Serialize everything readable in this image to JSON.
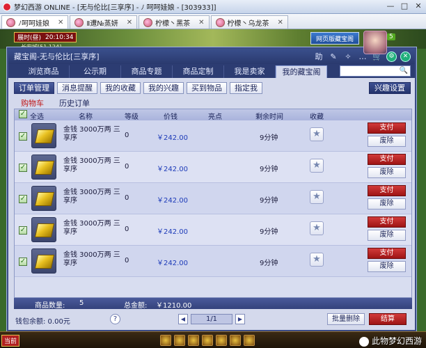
{
  "window": {
    "title": "梦幻西游 ONLINE - [无与伦比[三享序] - ﾉ 呵呵娃娘 - [303933]]",
    "minimize": "—",
    "maximize": "□",
    "close": "✕"
  },
  "game_tabs": [
    {
      "label": "ﾉ呵呵娃娘"
    },
    {
      "label": "Ⅱ遭№蒸妍"
    },
    {
      "label": "柠檬丶黑茶"
    },
    {
      "label": "柠檬丶乌龙茶"
    }
  ],
  "hud": {
    "clock_label": "展时(昼)",
    "clock_time": "20:10:34",
    "location": "长安城[51,124]",
    "web_button": "网页版藏宝阁",
    "level": "5"
  },
  "panel": {
    "title": "藏宝阁-无与伦比[三享序]",
    "controls": {
      "help": "助",
      "edit": "✎",
      "feather": "✧",
      "chat": "…",
      "cart": "🛒",
      "cart_badge": "5",
      "gear": "⚙",
      "close": "✕"
    }
  },
  "main_tabs": [
    {
      "label": "浏览商品",
      "active": false
    },
    {
      "label": "公示期",
      "active": false
    },
    {
      "label": "商品专题",
      "active": false
    },
    {
      "label": "商品定制",
      "active": false
    },
    {
      "label": "我是卖家",
      "active": false
    },
    {
      "label": "我的藏宝阁",
      "active": true
    }
  ],
  "search": {
    "placeholder": "",
    "value": ""
  },
  "sub_tabs": [
    {
      "label": "订单管理",
      "active": true
    },
    {
      "label": "消息提醒",
      "active": false
    },
    {
      "label": "我的收藏",
      "active": false
    },
    {
      "label": "我的兴趣",
      "active": false
    },
    {
      "label": "买到物品",
      "active": false
    },
    {
      "label": "指定我",
      "active": false
    }
  ],
  "interest_button": "兴趣设置",
  "cart_tabs": {
    "cart": "购物车",
    "history": "历史订单"
  },
  "table": {
    "headers": {
      "select_all": "全选",
      "name": "名称",
      "level": "等级",
      "price": "价钱",
      "highlight": "亮点",
      "remaining": "剩余时间",
      "favorite": "收藏"
    },
    "rows": [
      {
        "name": "金钱 3000万两 三享序",
        "level": "0",
        "price": "￥242.00",
        "remaining": "9分钟",
        "pay": "支付",
        "delete": "废除"
      },
      {
        "name": "金钱 3000万两 三享序",
        "level": "0",
        "price": "￥242.00",
        "remaining": "9分钟",
        "pay": "支付",
        "delete": "废除"
      },
      {
        "name": "金钱 3000万两 三享序",
        "level": "0",
        "price": "￥242.00",
        "remaining": "9分钟",
        "pay": "支付",
        "delete": "废除"
      },
      {
        "name": "金钱 3000万两 三享序",
        "level": "0",
        "price": "￥242.00",
        "remaining": "9分钟",
        "pay": "支付",
        "delete": "废除"
      },
      {
        "name": "金钱 3000万两 三享序",
        "level": "0",
        "price": "￥242.00",
        "remaining": "9分钟",
        "pay": "支付",
        "delete": "废除"
      }
    ]
  },
  "summary": {
    "count_label": "商品数量:",
    "count": "5",
    "total_label": "总金额:",
    "total": "￥1210.00"
  },
  "footer": {
    "wallet": "钱包余额: 0.00元",
    "help": "?",
    "page": "1/1",
    "prev": "◀",
    "next": "▶",
    "bulk_delete": "批量删除",
    "checkout": "结算"
  },
  "gamebar": {
    "dang": "当前",
    "watermark": "此物梦幻西游"
  },
  "colors": {
    "panel_header": "#2a3a6e",
    "pay_button": "#9e1414",
    "price_text": "#1c3ab8"
  }
}
